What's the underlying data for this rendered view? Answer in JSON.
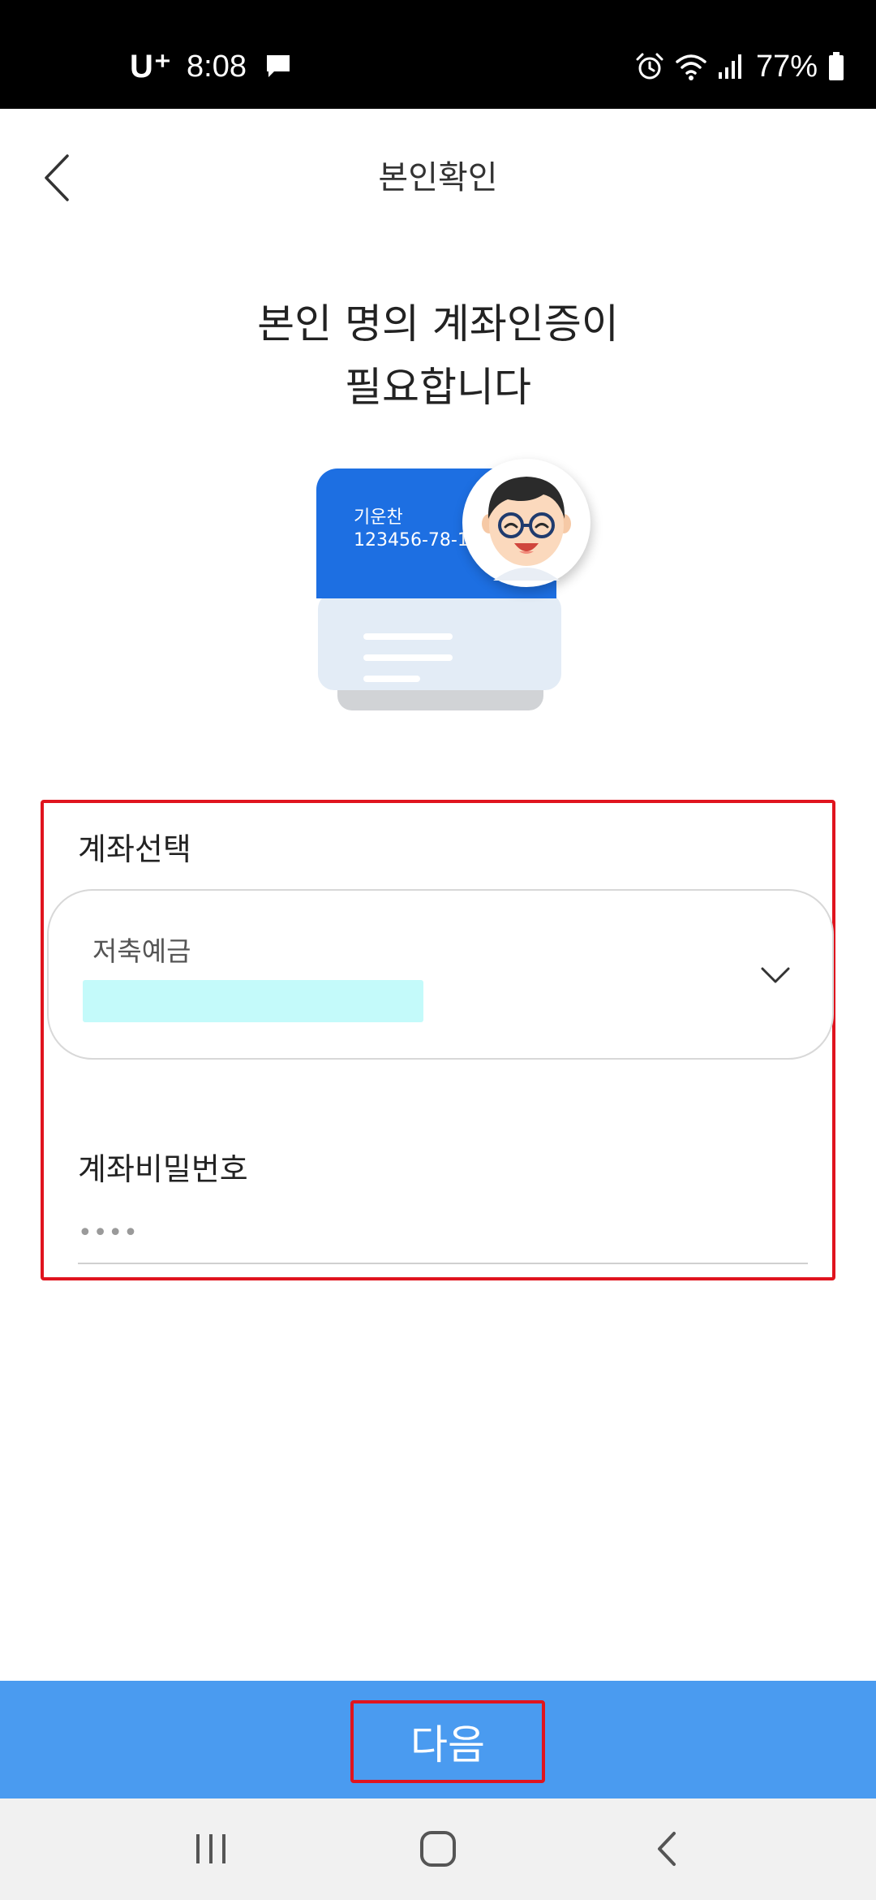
{
  "status_bar": {
    "carrier": "U⁺",
    "time": "8:08",
    "battery": "77%",
    "icons": [
      "message-icon",
      "alarm-icon",
      "wifi-icon",
      "signal-icon",
      "battery-icon"
    ]
  },
  "header": {
    "title": "본인확인",
    "back_icon": "chevron-left-icon"
  },
  "headline": {
    "line1": "본인 명의 계좌인증이",
    "line2": "필요합니다"
  },
  "illustration": {
    "card_name": "기운찬",
    "card_number": "123456-78-1"
  },
  "form": {
    "account_label": "계좌선택",
    "account_type": "저축예금",
    "dropdown_icon": "chevron-down-icon",
    "password_label": "계좌비밀번호",
    "password_placeholder": "••••"
  },
  "next_button": {
    "label": "다음"
  },
  "nav": {
    "icons": [
      "recent-apps-icon",
      "home-icon",
      "back-icon"
    ]
  },
  "colors": {
    "status_bar": "#000000",
    "primary": "#4a9bf0",
    "card_blue": "#1d6fe2",
    "highlight_border": "#e0141e",
    "masked_value": "#c4fafa"
  }
}
